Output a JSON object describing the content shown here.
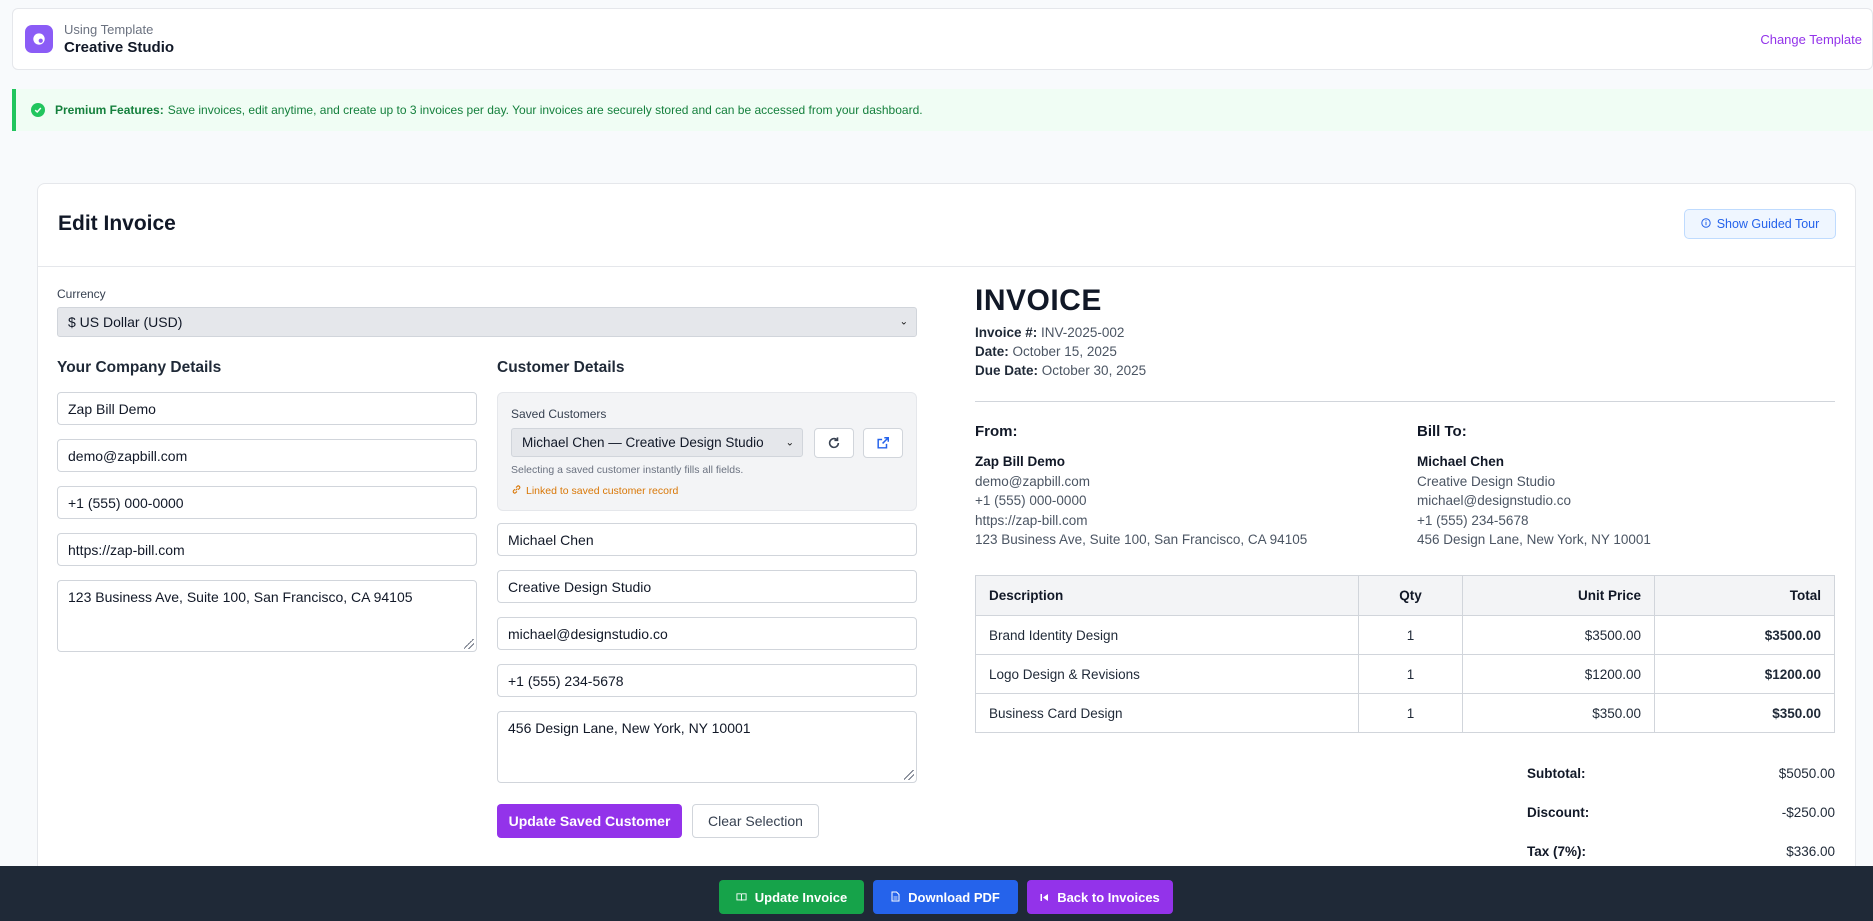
{
  "template": {
    "label": "Using Template",
    "name": "Creative Studio",
    "change_label": "Change Template"
  },
  "premium": {
    "title": "Premium Features:",
    "text": "Save invoices, edit anytime, and create up to 3 invoices per day. Your invoices are securely stored and can be accessed from your dashboard."
  },
  "page": {
    "title": "Edit Invoice",
    "tour_label": "Show Guided Tour"
  },
  "currency": {
    "label": "Currency",
    "value": "$ US Dollar (USD)"
  },
  "company": {
    "title": "Your Company Details",
    "name": "Zap Bill Demo",
    "email": "demo@zapbill.com",
    "phone": "+1 (555) 000-0000",
    "website": "https://zap-bill.com",
    "address": "123 Business Ave, Suite 100, San Francisco, CA 94105"
  },
  "customer": {
    "title": "Customer Details",
    "saved_label": "Saved Customers",
    "saved_value": "Michael Chen — Creative Design Studio",
    "hint": "Selecting a saved customer instantly fills all fields.",
    "linked": "Linked to saved customer record",
    "name": "Michael Chen",
    "company": "Creative Design Studio",
    "email": "michael@designstudio.co",
    "phone": "+1 (555) 234-5678",
    "address": "456 Design Lane, New York, NY 10001",
    "update_label": "Update Saved Customer",
    "clear_label": "Clear Selection"
  },
  "invoice": {
    "heading": "INVOICE",
    "number_label": "Invoice #:",
    "number": "INV-2025-002",
    "date_label": "Date:",
    "date": "October 15, 2025",
    "due_label": "Due Date:",
    "due": "October 30, 2025",
    "from_label": "From:",
    "from": {
      "name": "Zap Bill Demo",
      "email": "demo@zapbill.com",
      "phone": "+1 (555) 000-0000",
      "website": "https://zap-bill.com",
      "address": "123 Business Ave, Suite 100, San Francisco, CA 94105"
    },
    "to_label": "Bill To:",
    "to": {
      "name": "Michael Chen",
      "company": "Creative Design Studio",
      "email": "michael@designstudio.co",
      "phone": "+1 (555) 234-5678",
      "address": "456 Design Lane, New York, NY 10001"
    },
    "columns": [
      "Description",
      "Qty",
      "Unit Price",
      "Total"
    ],
    "items": [
      {
        "desc": "Brand Identity Design",
        "qty": "1",
        "price": "$3500.00",
        "total": "$3500.00"
      },
      {
        "desc": "Logo Design & Revisions",
        "qty": "1",
        "price": "$1200.00",
        "total": "$1200.00"
      },
      {
        "desc": "Business Card Design",
        "qty": "1",
        "price": "$350.00",
        "total": "$350.00"
      }
    ],
    "subtotal_label": "Subtotal:",
    "subtotal": "$5050.00",
    "discount_label": "Discount:",
    "discount": "-$250.00",
    "tax_label": "Tax (7%):",
    "tax": "$336.00"
  },
  "footer": {
    "update_label": "Update Invoice",
    "download_label": "Download PDF",
    "back_label": "Back to Invoices"
  },
  "colors": {
    "purple": "#9333ea",
    "green": "#16a34a",
    "blue": "#2563eb",
    "footer": "#1f2937"
  }
}
